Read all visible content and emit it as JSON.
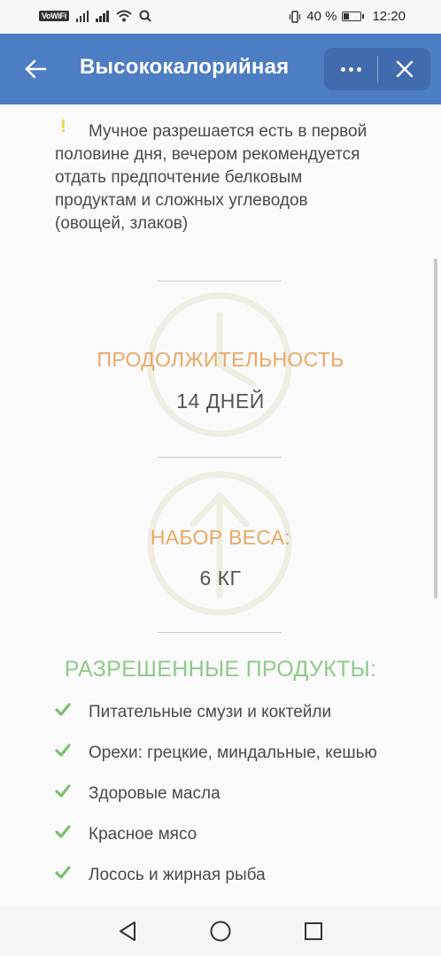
{
  "status_bar": {
    "vowifi": "VoWiFi",
    "battery_percent": "40 %",
    "battery_level": 0.4,
    "time": "12:20"
  },
  "app_bar": {
    "title": "Высококалорийная",
    "color": "#4d7dc2"
  },
  "note": {
    "icon": "exclamation-icon",
    "text": "Мучное разрешается есть в первой половине дня, вечером рекомендуется отдать предпочтение белковым продуктам и сложных углеводов (овощей, злаков)"
  },
  "duration": {
    "icon": "clock-icon",
    "label": "ПРОДОЛЖИТЕЛЬНОСТЬ",
    "value": "14 ДНЕЙ"
  },
  "weight_gain": {
    "icon": "arrow-up-circle-icon",
    "label": "НАБОР ВЕСА:",
    "value": "6 КГ"
  },
  "allowed": {
    "title": "РАЗРЕШЕННЫЕ ПРОДУКТЫ:",
    "check_icon": "check-icon",
    "items": [
      "Питательные смузи и коктейли",
      "Орехи: грецкие, миндальные, кешью",
      "Здоровые масла",
      "Красное мясо",
      "Лосось и жирная рыба"
    ]
  },
  "colors": {
    "accent_orange": "#e8a866",
    "accent_green": "#90c98a",
    "check_green": "#7cbf6e"
  }
}
